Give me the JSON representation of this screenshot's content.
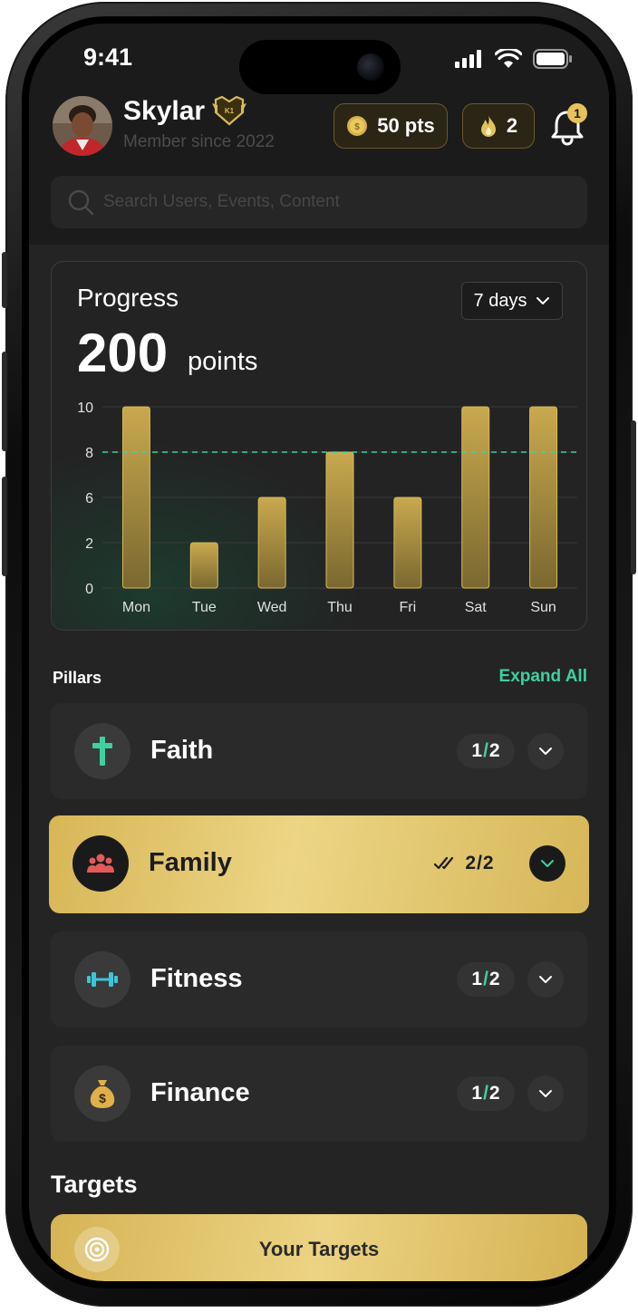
{
  "status_bar": {
    "time": "9:41"
  },
  "header": {
    "user_name": "Skylar",
    "rank_badge": "K1",
    "member_since": "Member since 2022",
    "points_pill": "50 pts",
    "streak_pill": "2",
    "notifications_count": "1"
  },
  "search": {
    "placeholder": "Search Users, Events, Content"
  },
  "progress": {
    "title": "Progress",
    "points_value": "200",
    "points_unit": "points",
    "range_label": "7 days"
  },
  "chart_data": {
    "type": "bar",
    "categories": [
      "Mon",
      "Tue",
      "Wed",
      "Thu",
      "Fri",
      "Sat",
      "Sun"
    ],
    "values": [
      10,
      2,
      6,
      8,
      6,
      10,
      10
    ],
    "y_ticks": [
      "10",
      "8",
      "6",
      "2",
      "0"
    ],
    "target_line": 8,
    "grid": true,
    "bar_color": "#c9a94e",
    "target_line_color": "#3fd0a0"
  },
  "pillars": {
    "section_label": "Pillars",
    "expand_all": "Expand All",
    "items": [
      {
        "name": "Faith",
        "done": "1",
        "sep": "/",
        "total": "2",
        "icon": "cross-icon"
      },
      {
        "name": "Family",
        "done": "2",
        "sep": "/",
        "total": "2",
        "icon": "family-icon",
        "active": true
      },
      {
        "name": "Fitness",
        "done": "1",
        "sep": "/",
        "total": "2",
        "icon": "dumbbell-icon"
      },
      {
        "name": "Finance",
        "done": "1",
        "sep": "/",
        "total": "2",
        "icon": "money-bag-icon"
      }
    ]
  },
  "targets": {
    "title": "Targets",
    "button_label": "Your Targets"
  },
  "colors": {
    "accent_gold": "#d9b95a",
    "accent_green": "#3fd0a0",
    "background": "#242424"
  }
}
